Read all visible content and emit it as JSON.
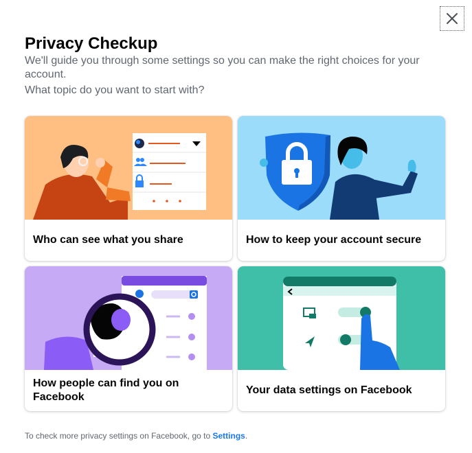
{
  "dialog": {
    "close_icon": "close-icon",
    "title": "Privacy Checkup",
    "description": "We'll guide you through some settings so you can make the right choices for your account.",
    "question": "What topic do you want to start with?"
  },
  "topics": [
    {
      "label": "Who can see what you share",
      "icon": "sharing-illustration",
      "bg": "#ffbf82"
    },
    {
      "label": "How to keep your account secure",
      "icon": "security-shield-illustration",
      "bg": "#9bdcfa"
    },
    {
      "label": "How people can find you on Facebook",
      "icon": "magnifier-search-illustration",
      "bg": "#c6aaf5"
    },
    {
      "label": "Your data settings on Facebook",
      "icon": "data-settings-illustration",
      "bg": "#3fbfa8"
    }
  ],
  "footer": {
    "text": "To check more privacy settings on Facebook, go to",
    "link": "Settings",
    "suffix": "."
  },
  "colors": {
    "accent": "#1877f2",
    "text": "#050505",
    "secondary": "#606770"
  }
}
